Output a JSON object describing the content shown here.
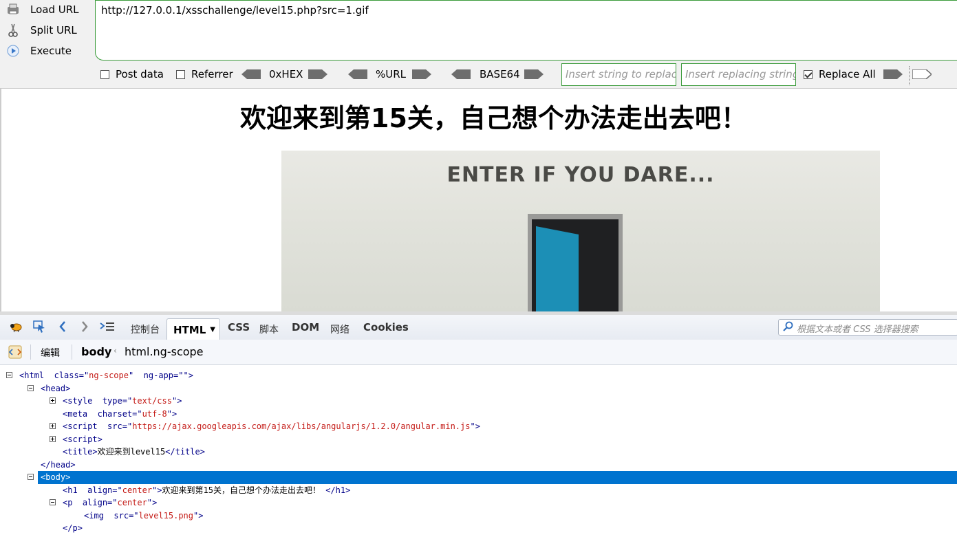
{
  "hackbar": {
    "load_label": "Load URL",
    "split_label": "Split URL",
    "execute_label": "Execute",
    "url": "http://127.0.0.1/xsschallenge/level15.php?src=1.gif",
    "post_data_label": "Post data",
    "referrer_label": "Referrer",
    "hex_label": "0xHEX",
    "url_enc_label": "%URL",
    "base64_label": "BASE64",
    "replace_placeholder": "Insert string to replace",
    "replacing_placeholder": "Insert replacing string",
    "replace_all_label": "Replace All",
    "replace_all_checked": true
  },
  "page": {
    "heading": "欢迎来到第15关，自己想个办法走出去吧！",
    "image_text": "ENTER IF YOU DARE..."
  },
  "devtools": {
    "tabs": {
      "console": "控制台",
      "html": "HTML",
      "css": "CSS",
      "script": "脚本",
      "dom": "DOM",
      "net": "网络",
      "cookies": "Cookies"
    },
    "search_placeholder": "根据文本或者 CSS 选择器搜索",
    "edit_label": "编辑",
    "crumb_body": "body",
    "crumb_html": "html.ng-scope",
    "tree": {
      "html_tag": "html",
      "html_class_attr": "class",
      "html_class_val": "ng-scope",
      "html_ngapp_attr": "ng-app",
      "html_ngapp_val": "",
      "head": "head",
      "style_tag": "style",
      "style_attr": "type",
      "style_val": "text/css",
      "meta_tag": "meta",
      "meta_attr": "charset",
      "meta_val": "utf-8",
      "script1_tag": "script",
      "script1_attr": "src",
      "script1_val": "https://ajax.googleapis.com/ajax/libs/angularjs/1.2.0/angular.min.js",
      "script2_tag": "script",
      "title_tag": "title",
      "title_text": "欢迎来到level15",
      "head_close": "head",
      "body": "body",
      "h1_tag": "h1",
      "h1_attr": "align",
      "h1_val": "center",
      "h1_text": "欢迎来到第15关，自己想个办法走出去吧！",
      "p_tag": "p",
      "p_attr": "align",
      "p_val": "center",
      "img_tag": "img",
      "img_attr": "src",
      "img_val": "level15.png",
      "p_close": "p"
    }
  },
  "colors": {
    "accent": "#0073cf",
    "tag": "#000088",
    "attr_value": "#c41a16",
    "hackbar_border": "#3a9b3a"
  }
}
